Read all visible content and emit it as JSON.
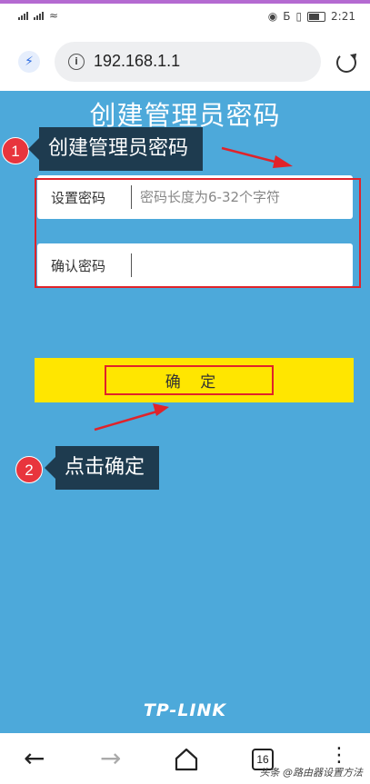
{
  "status_bar": {
    "time": "2:21"
  },
  "browser": {
    "url": "192.168.1.1",
    "tab_count": "16"
  },
  "page": {
    "title": "创建管理员密码",
    "set_password": {
      "label": "设置密码",
      "placeholder": "密码长度为6-32个字符",
      "value": ""
    },
    "confirm_password": {
      "label": "确认密码",
      "placeholder": "",
      "value": ""
    },
    "confirm_button": "确 定",
    "logo": "TP-LINK"
  },
  "annotations": {
    "step1": {
      "number": "1",
      "text": "创建管理员密码"
    },
    "step2": {
      "number": "2",
      "text": "点击确定"
    }
  },
  "watermark": "头条 @路由器设置方法",
  "colors": {
    "background": "#4da9da",
    "button": "#ffe600",
    "highlight": "#e0232a",
    "callout": "#1e3b4f",
    "badge": "#e8353d"
  }
}
